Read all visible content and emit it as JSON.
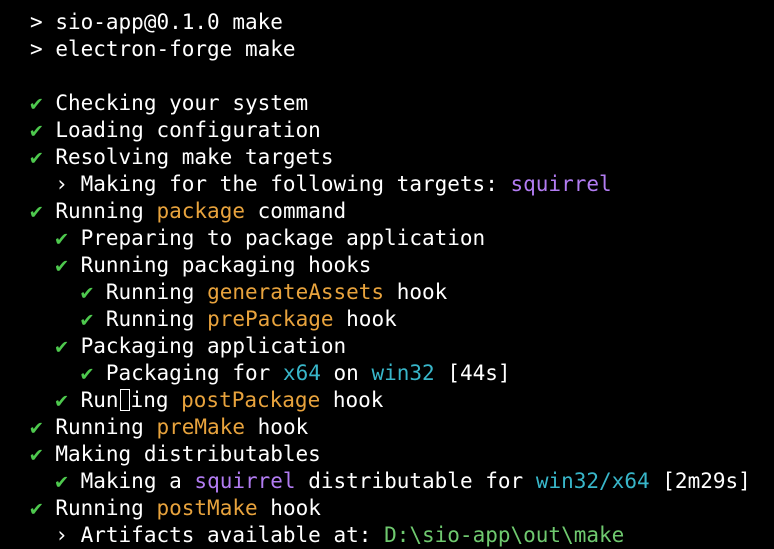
{
  "terminal": {
    "npm_prompt": ">",
    "npm_script": "sio-app@0.1.0 make",
    "npm_command": "electron-forge make",
    "check_glyph": "✔",
    "sub_glyph": "›",
    "lines": {
      "checking": "Checking your system",
      "loading": "Loading configuration",
      "resolving": "Resolving make targets",
      "making_for_prefix": "Making for the following targets:",
      "making_for_target": "squirrel",
      "running_package_prefix": "Running",
      "running_package_hl": "package",
      "running_package_suffix": "command",
      "preparing": "Preparing to package application",
      "running_packaging_hooks": "Running packaging hooks",
      "gen_prefix": "Running",
      "gen_hl": "generateAssets",
      "gen_suffix": "hook",
      "pre_prefix": "Running",
      "pre_hl": "prePackage",
      "pre_suffix": "hook",
      "packaging_app": "Packaging application",
      "packaging_for_prefix": "Packaging for",
      "packaging_for_arch": "x64",
      "packaging_on": "on",
      "packaging_platform": "win32",
      "packaging_time": "[44s]",
      "post_prefix_a": "Run",
      "post_prefix_b": "ing",
      "post_hl": "postPackage",
      "post_suffix": "hook",
      "premake_prefix": "Running",
      "premake_hl": "preMake",
      "premake_suffix": "hook",
      "making_dist": "Making distributables",
      "making_a_prefix": "Making a",
      "making_a_hl": "squirrel",
      "making_a_mid": "distributable for",
      "making_a_platform": "win32/x64",
      "making_a_time": "[2m29s]",
      "postmake_prefix": "Running",
      "postmake_hl": "postMake",
      "postmake_suffix": "hook",
      "artifacts_prefix": "Artifacts available at:",
      "artifacts_path": "D:\\sio-app\\out\\make"
    }
  }
}
